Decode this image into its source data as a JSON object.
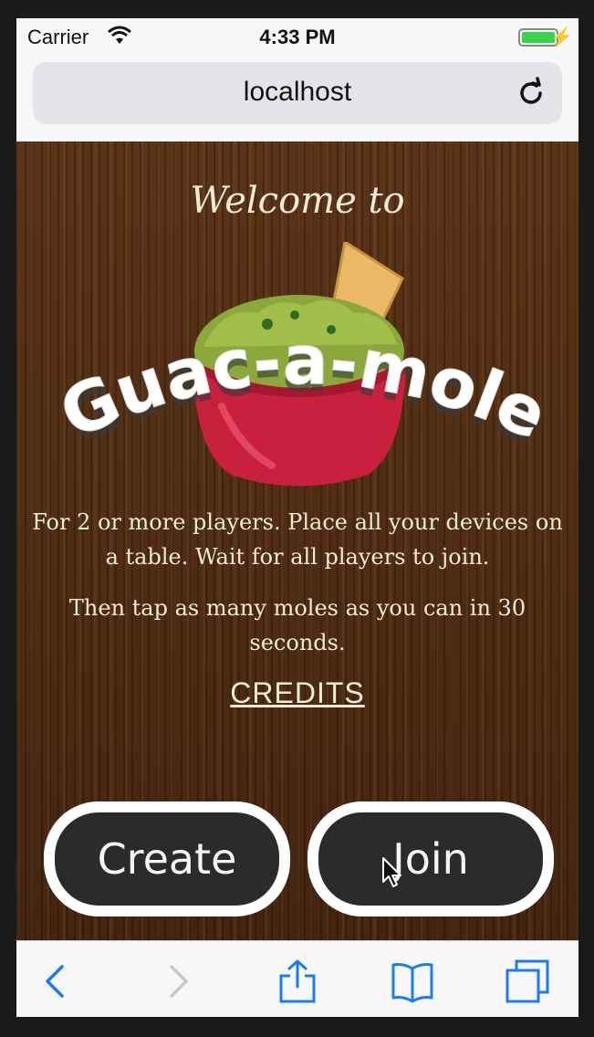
{
  "status_bar": {
    "carrier": "Carrier",
    "time": "4:33 PM",
    "icons": [
      "wifi-icon",
      "battery-icon",
      "charging-bolt-icon"
    ],
    "battery_color": "#36d44a"
  },
  "browser": {
    "url": "localhost",
    "reload_icon": "reload-icon"
  },
  "game": {
    "welcome": "Welcome to",
    "logo_text": "Guac-a-mole",
    "intro_line_1": "For 2 or more players. Place all your devices on a table. Wait for all players to join.",
    "intro_line_2": "Then tap as many moles as you can in 30 seconds.",
    "credits_link": "CREDITS",
    "create_button": "Create",
    "join_button": "Join"
  },
  "toolbar": {
    "icons": [
      "back-icon",
      "forward-icon",
      "share-icon",
      "bookmarks-icon",
      "tabs-icon"
    ],
    "accent": "#1a7cf5"
  }
}
